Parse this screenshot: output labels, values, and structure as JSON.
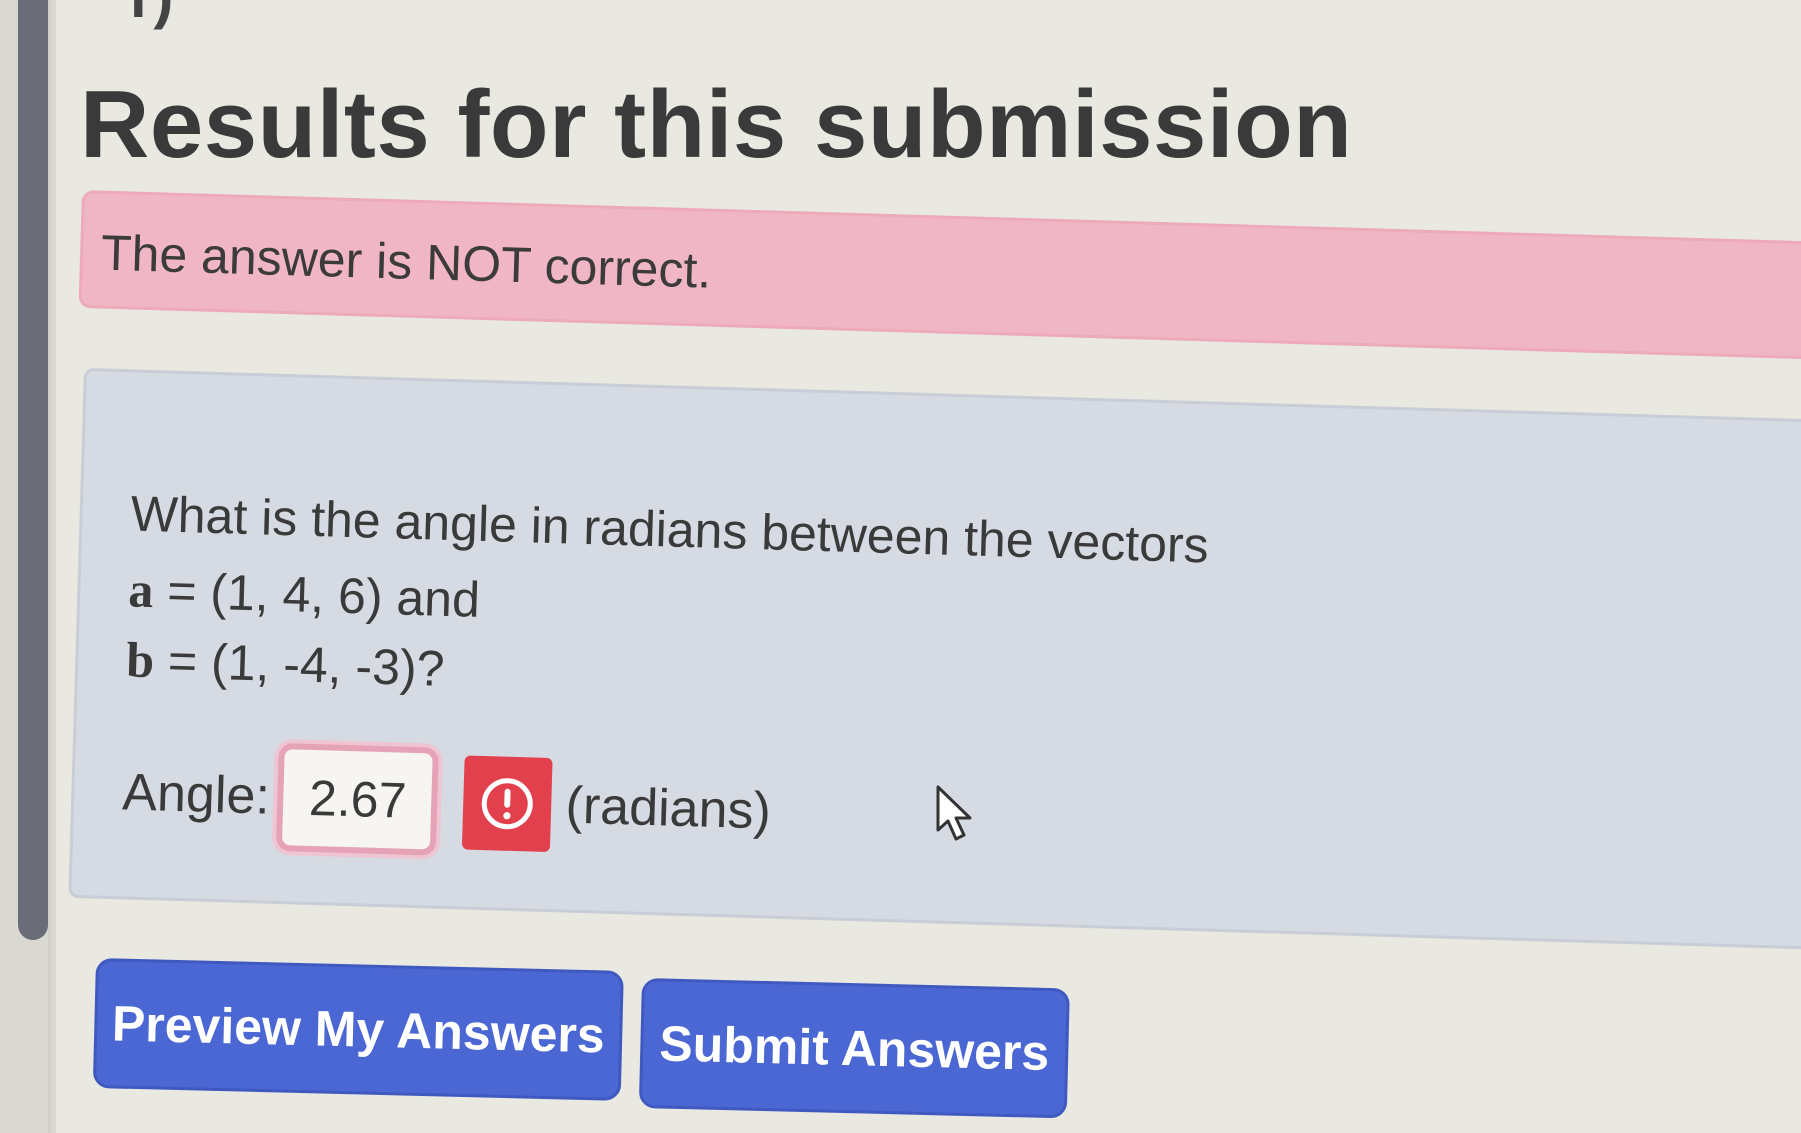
{
  "header": {
    "title_fragment": "r)",
    "title": "Results for this submission"
  },
  "alert": {
    "message": "The answer is NOT correct.",
    "color": "#f1b6c6"
  },
  "problem": {
    "question": "What is the angle in radians between the vectors",
    "vector_a_symbol": "a",
    "vector_a_value": " = (1, 4, 6) and",
    "vector_b_symbol": "b",
    "vector_b_value": " = (1, -4, -3)?",
    "answer_label": "Angle:",
    "answer_value": "2.67",
    "units_label": "(radians)",
    "status_icon": "error-icon",
    "error_color": "#e2404c"
  },
  "buttons": {
    "preview_label": "Preview My Answers",
    "submit_label": "Submit Answers",
    "accent": "#4b67d4"
  },
  "cursor": {
    "icon": "mouse-pointer-icon"
  }
}
